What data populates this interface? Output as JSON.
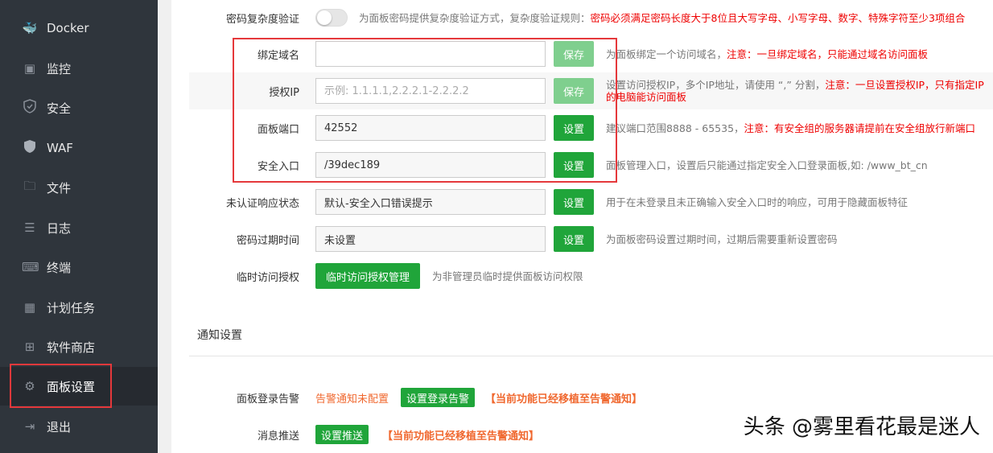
{
  "sidebar": {
    "items": [
      {
        "label": "Docker",
        "icon": "docker-icon"
      },
      {
        "label": "监控",
        "icon": "monitor-icon"
      },
      {
        "label": "安全",
        "icon": "shield-icon"
      },
      {
        "label": "WAF",
        "icon": "waf-shield-icon"
      },
      {
        "label": "文件",
        "icon": "folder-icon"
      },
      {
        "label": "日志",
        "icon": "log-icon"
      },
      {
        "label": "终端",
        "icon": "terminal-icon"
      },
      {
        "label": "计划任务",
        "icon": "calendar-icon"
      },
      {
        "label": "软件商店",
        "icon": "apps-icon"
      },
      {
        "label": "面板设置",
        "icon": "gear-icon",
        "active": true
      },
      {
        "label": "退出",
        "icon": "logout-icon"
      }
    ]
  },
  "settings": {
    "pwd_complexity": {
      "label": "密码复杂度验证",
      "desc": "为面板密码提供复杂度验证方式，复杂度验证规则：",
      "warn": "密码必须满足密码长度大于8位且大写字母、小写字母、数字、特殊字符至少3项组合"
    },
    "domain": {
      "label": "绑定域名",
      "value": "",
      "button": "保存",
      "desc": "为面板绑定一个访问域名，",
      "warn": "注意：一旦绑定域名，只能通过域名访问面板"
    },
    "auth_ip": {
      "label": "授权IP",
      "placeholder": "示例: 1.1.1.1,2.2.2.1-2.2.2.2",
      "button": "保存",
      "desc": "设置访问授权IP，多个IP地址，请使用 “,” 分割，",
      "warn": "注意：一旦设置授权IP，只有指定IP的电脑能访问面板"
    },
    "port": {
      "label": "面板端口",
      "value": "42552",
      "button": "设置",
      "desc": "建议端口范围8888 - 65535，",
      "warn": "注意：有安全组的服务器请提前在安全组放行新端口"
    },
    "entry": {
      "label": "安全入口",
      "value": "/39dec189",
      "button": "设置",
      "desc": "面板管理入口，设置后只能通过指定安全入口登录面板,如: /www_bt_cn"
    },
    "unauth": {
      "label": "未认证响应状态",
      "value": "默认-安全入口错误提示",
      "button": "设置",
      "desc": "用于在未登录且未正确输入安全入口时的响应，可用于隐藏面板特征"
    },
    "pwd_expire": {
      "label": "密码过期时间",
      "value": "未设置",
      "button": "设置",
      "desc": "为面板密码设置过期时间，过期后需要重新设置密码"
    },
    "temp_access": {
      "label": "临时访问授权",
      "button": "临时访问授权管理",
      "desc": "为非管理员临时提供面板访问权限"
    }
  },
  "notify": {
    "title": "通知设置",
    "login_alert": {
      "label": "面板登录告警",
      "status": "告警通知未配置",
      "button": "设置登录告警",
      "note": "【当前功能已经移植至告警通知】"
    },
    "push": {
      "label": "消息推送",
      "button": "设置推送",
      "note": "【当前功能已经移植至告警通知】"
    }
  },
  "watermark": "头条 @雾里看花最是迷人"
}
